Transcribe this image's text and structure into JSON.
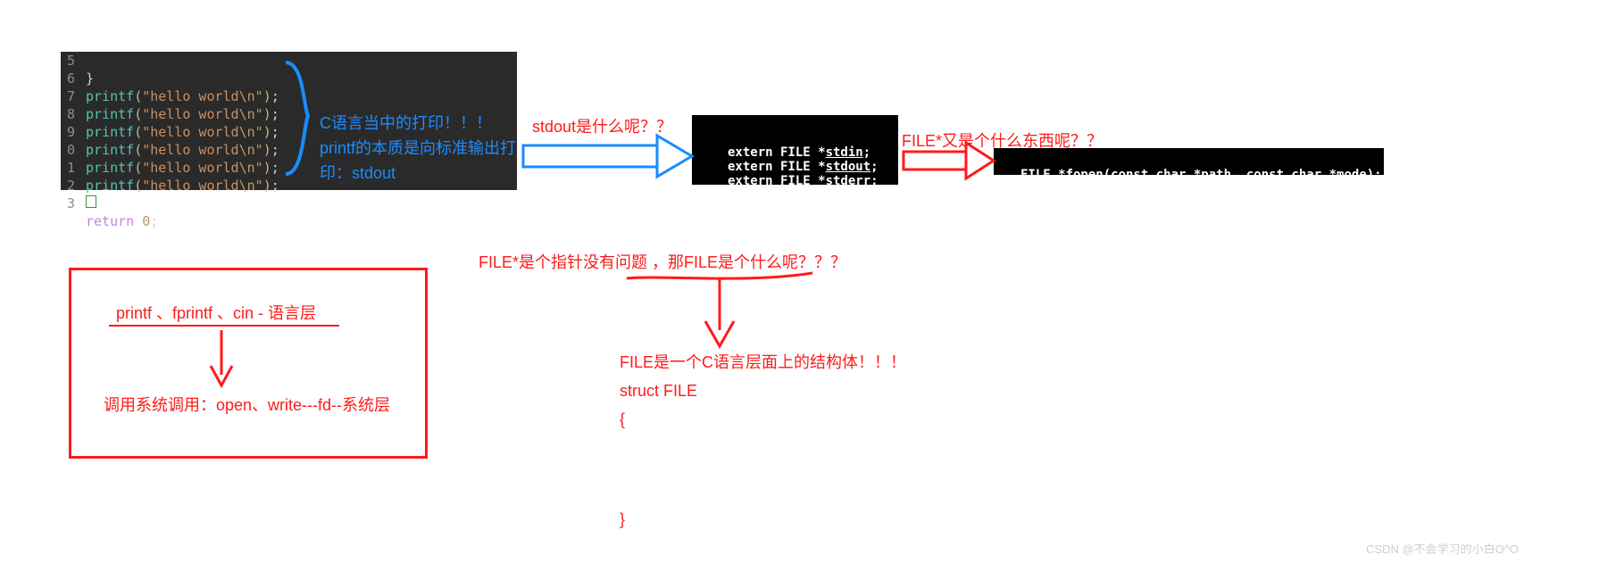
{
  "code_block1": {
    "line_numbers": [
      "5",
      "6",
      "7",
      "8",
      "9",
      "0",
      "1",
      "2",
      "3"
    ],
    "printf_call_text": "printf(\"hello world\\n\");",
    "return_stmt": "return 0;"
  },
  "annot_blue": {
    "line1": "C语言当中的打印！！！",
    "line2": "printf的本质是向标准输出打",
    "line3": "印：stdout"
  },
  "annot_stdout_q": "stdout是什么呢？？",
  "extern_block": {
    "l1_pre": "extern FILE *",
    "l1_id": "stdin",
    "l2_pre": "extern FILE *",
    "l2_id": "stdout",
    "l3_pre": "extern FILE *",
    "l3_id": "stderr",
    "semicolon": ";"
  },
  "annot_file_q": "FILE*又是个什么东西呢？？",
  "fopen_block": {
    "pre": "FILE *fopen(const char *",
    "p1": "path",
    "mid": ", const char *",
    "p2": "mode",
    "post": ");"
  },
  "middle_q": "FILE*是个指针没有问题 ，那FILE是个什么呢？？？",
  "struct_text": {
    "l1": "FILE是一个C语言层面上的结构体！！！",
    "l2": "struct  FILE",
    "l3": "{",
    "l4": "}"
  },
  "left_box": {
    "l1": "printf 、fprintf 、cin - 语言层",
    "l2": "调用系统调用：open、write---fd--系统层"
  },
  "watermark": "CSDN @不会学习的小白O^O"
}
